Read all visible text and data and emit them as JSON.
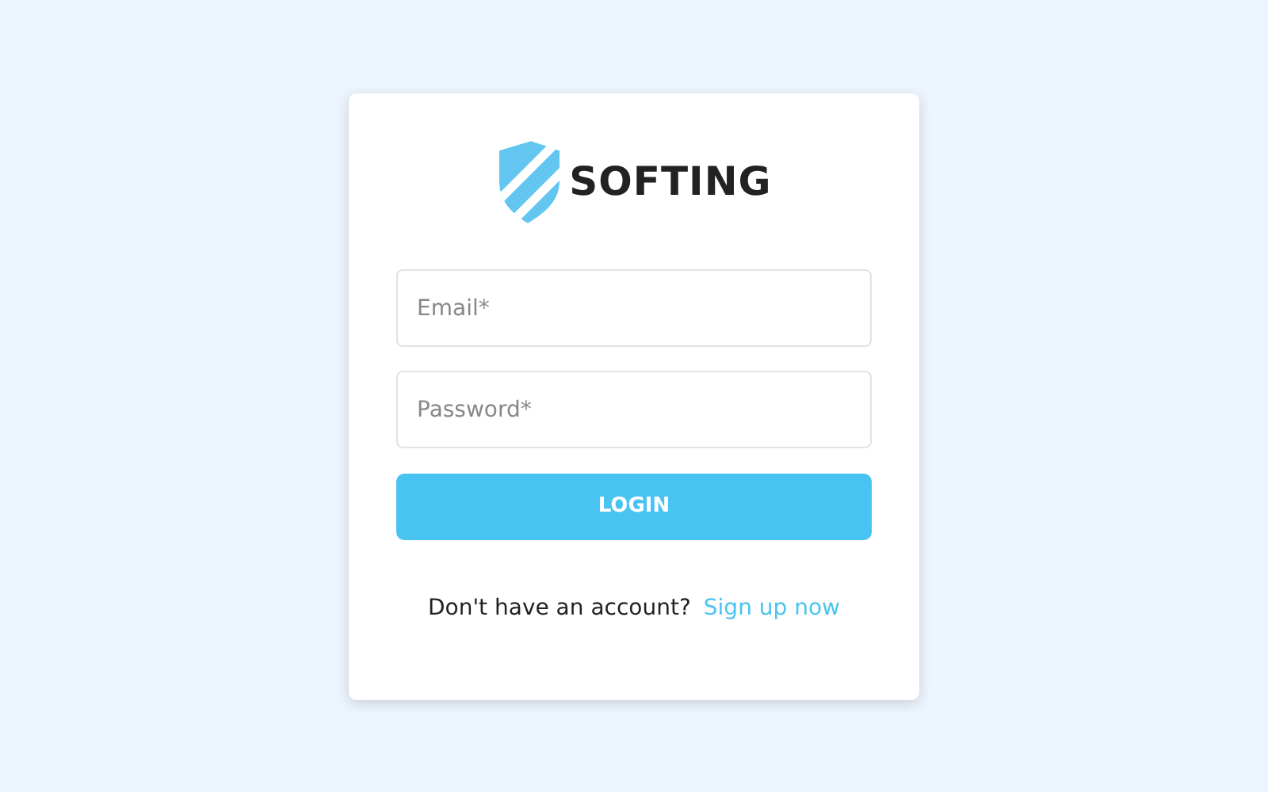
{
  "logo": {
    "text": "SOFTING"
  },
  "fields": [
    {
      "placeholder": "Email*"
    },
    {
      "placeholder": "Password*"
    }
  ],
  "login_button": {
    "label": "LOGIN"
  },
  "signup": {
    "prompt": "Don't have an account?",
    "link": "Sign up now"
  }
}
